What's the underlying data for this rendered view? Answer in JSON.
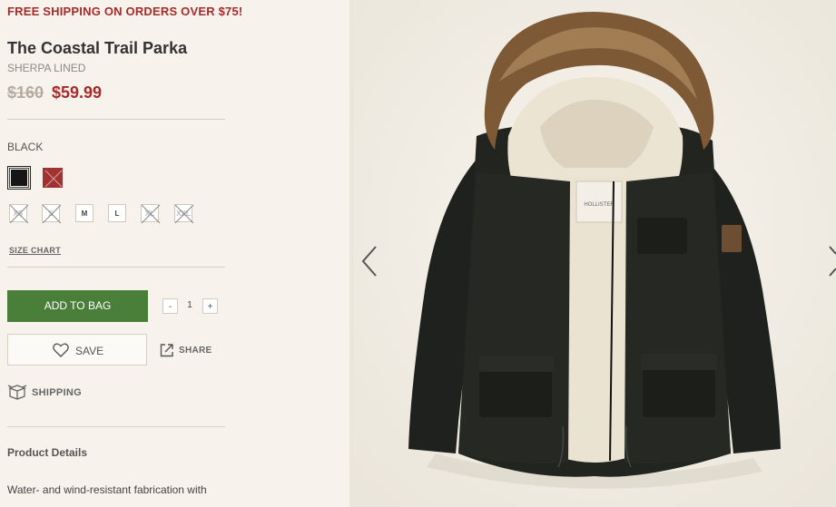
{
  "promo": "FREE SHIPPING ON ORDERS OVER $75!",
  "product": {
    "title": "The Coastal Trail Parka",
    "subtitle": "SHERPA LINED",
    "price_old": "$160",
    "price_new": "$59.99"
  },
  "color": {
    "label": "BLACK",
    "swatches": [
      {
        "name": "black",
        "hex": "#161616",
        "available": true,
        "selected": true
      },
      {
        "name": "red",
        "hex": "#a13232",
        "available": false
      }
    ]
  },
  "sizes": [
    {
      "label": "XS",
      "available": false
    },
    {
      "label": "S",
      "available": false
    },
    {
      "label": "M",
      "available": true
    },
    {
      "label": "L",
      "available": true
    },
    {
      "label": "XL",
      "available": false
    },
    {
      "label": "XXL",
      "available": false
    }
  ],
  "size_chart": "SIZE CHART",
  "actions": {
    "add_to_bag": "ADD TO BAG",
    "qty_minus": "-",
    "quantity": "1",
    "qty_plus": "+",
    "save": "SAVE",
    "share": "SHARE",
    "shipping": "SHIPPING"
  },
  "details": {
    "title": "Product Details",
    "text": "Water- and wind-resistant fabrication with"
  },
  "gallery": {
    "logo_text": "HOLLISTER",
    "prev_icon": "chevron-left-icon",
    "next_icon": "chevron-right-icon"
  },
  "colors": {
    "promo_red": "#a62b2b",
    "add_green": "#4a7f3a",
    "jacket": "#1d1f1c",
    "fur": "#7d5a35",
    "sherpa": "#ebe3d2"
  }
}
